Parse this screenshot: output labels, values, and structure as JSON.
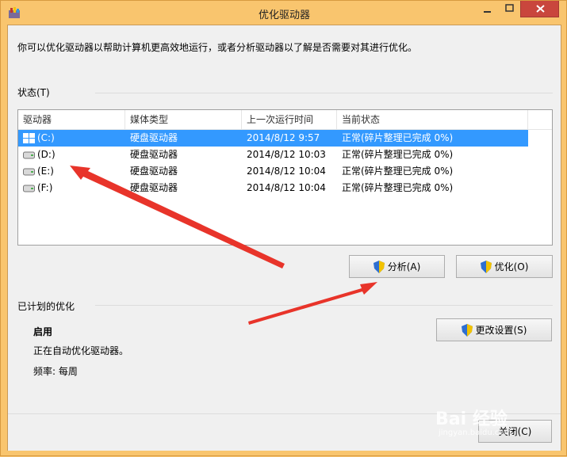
{
  "window": {
    "title": "优化驱动器"
  },
  "intro": "你可以优化驱动器以帮助计算机更高效地运行，或者分析驱动器以了解是否需要对其进行优化。",
  "status": {
    "label": "状态(T)"
  },
  "table": {
    "columns": [
      "驱动器",
      "媒体类型",
      "上一次运行时间",
      "当前状态"
    ],
    "rows": [
      {
        "drive": "(C:)",
        "media": "硬盘驱动器",
        "last_run": "2014/8/12 9:57",
        "state": "正常(碎片整理已完成 0%)",
        "selected": true,
        "icon": "windows-drive-icon"
      },
      {
        "drive": "(D:)",
        "media": "硬盘驱动器",
        "last_run": "2014/8/12 10:03",
        "state": "正常(碎片整理已完成 0%)",
        "selected": false,
        "icon": "drive-icon"
      },
      {
        "drive": "(E:)",
        "media": "硬盘驱动器",
        "last_run": "2014/8/12 10:04",
        "state": "正常(碎片整理已完成 0%)",
        "selected": false,
        "icon": "drive-icon"
      },
      {
        "drive": "(F:)",
        "media": "硬盘驱动器",
        "last_run": "2014/8/12 10:04",
        "state": "正常(碎片整理已完成 0%)",
        "selected": false,
        "icon": "drive-icon"
      }
    ]
  },
  "buttons": {
    "analyze": "分析(A)",
    "optimize": "优化(O)",
    "change_settings": "更改设置(S)",
    "close": "关闭(C)"
  },
  "schedule": {
    "label": "已计划的优化",
    "enabled": "启用",
    "description": "正在自动优化驱动器。",
    "frequency": "频率: 每周"
  },
  "watermark": {
    "text": "Bai 经验",
    "sub": "jingyan.baidu.com"
  },
  "colors": {
    "title_bar": "#f9c56e",
    "selection": "#3399ff",
    "arrow": "#e8342a",
    "close_button": "#c9463d"
  }
}
